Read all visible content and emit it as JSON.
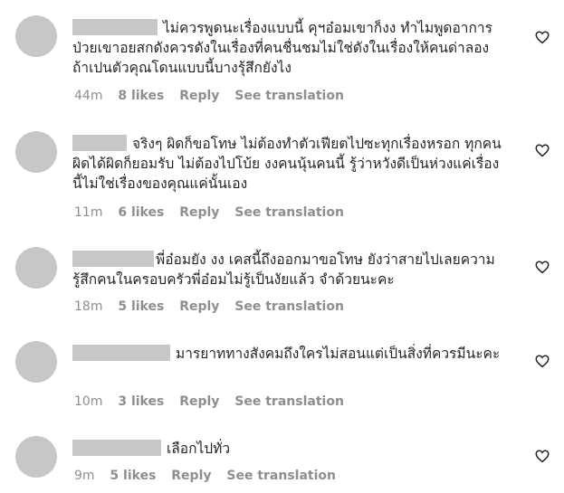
{
  "comments": [
    {
      "text": "ไม่ควรพูดนะเรื่องแบบนี้ คุฯอ๋อมเขาก็งง ทำไมพูดอาการป่วยเขาอยสกดังควรดังในเรื่องที่คนชื่นชมไม่ใช่ดังในเรื่องให้คนด่าลองถ้าเปนตัวคุณโดนแบบนี้บางรุ้สึกยังไง",
      "time": "44m",
      "likes": "8 likes",
      "reply": "Reply",
      "translate": "See translation"
    },
    {
      "text": "จริงๆ ผิดก็ขอโทษ ไม่ต้องทำตัวเฟียตไปซะทุกเรื่องหรอก ทุกคนผิดได้ผิดก็ยอมรับ ไม่ต้องไปโบ้ย งงคนนุ้นคนนี้ รู้ว่าหวังดีเป็นห่วงแค่เรื่องนี้ไม่ใช่เรื่องของคุณแค่นั้นเอง",
      "time": "11m",
      "likes": "6 likes",
      "reply": "Reply",
      "translate": "See translation"
    },
    {
      "text": "พี่อ๋อมยัง งง เคสนี้ถึงออกมาขอโทษ ยังว่าสายไปเลยความรู้สึกคนในครอบครัวพี่อ๋อมไม่รู้เป็นงัยแล้ว จำด้วยนะคะ",
      "time": "18m",
      "likes": "5 likes",
      "reply": "Reply",
      "translate": "See translation"
    },
    {
      "text": "มารยาททางสังคมถึงใครไม่สอนแต่เป็นสิ่งที่ควรมีนะคะ",
      "time": "10m",
      "likes": "3 likes",
      "reply": "Reply",
      "translate": "See translation"
    },
    {
      "text": "เลือกไปทั่ว",
      "time": "9m",
      "likes": "5 likes",
      "reply": "Reply",
      "translate": "See translation"
    }
  ],
  "icons": {
    "like": "heart-outline-icon"
  }
}
